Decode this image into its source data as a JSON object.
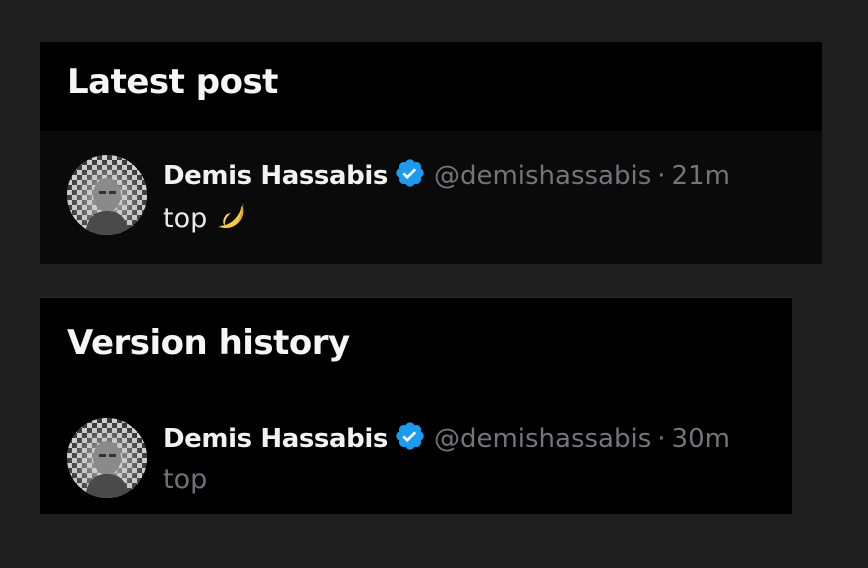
{
  "latest_post": {
    "title": "Latest post",
    "author": {
      "name": "Demis Hassabis",
      "handle": "@demishassabis",
      "verified": true,
      "verified_icon": "verified-badge-icon"
    },
    "separator": "·",
    "time": "21m",
    "text": "top",
    "emoji_icon": "banana-icon"
  },
  "version_history": {
    "title": "Version history",
    "author": {
      "name": "Demis Hassabis",
      "handle": "@demishassabis",
      "verified": true,
      "verified_icon": "verified-badge-icon"
    },
    "separator": "·",
    "time": "30m",
    "text": "top"
  },
  "colors": {
    "page_background": "#1f1f1f",
    "card_background": "#000000",
    "verified_blue": "#1d9bf0",
    "muted_text": "#71767b",
    "primary_text": "#e7e9ea"
  }
}
